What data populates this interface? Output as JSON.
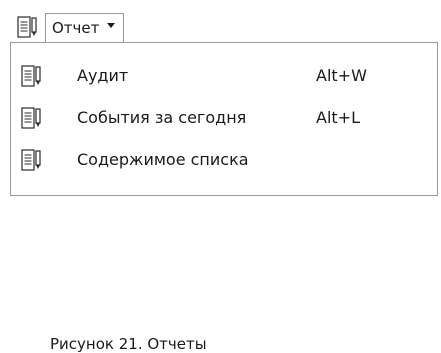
{
  "toolbar": {
    "label": "Отчет",
    "icon": "report-document-icon"
  },
  "menu": {
    "items": [
      {
        "label": "Аудит",
        "shortcut": "Alt+W",
        "icon": "report-document-icon"
      },
      {
        "label": "События за сегодня",
        "shortcut": "Alt+L",
        "icon": "report-document-icon"
      },
      {
        "label": "Содержимое списка",
        "shortcut": "",
        "icon": "report-document-icon"
      }
    ]
  },
  "caption": {
    "text": "Рисунок 21. Отчеты"
  },
  "colors": {
    "border": "#9a9a9a",
    "text": "#1a1a1a",
    "background": "#ffffff"
  }
}
